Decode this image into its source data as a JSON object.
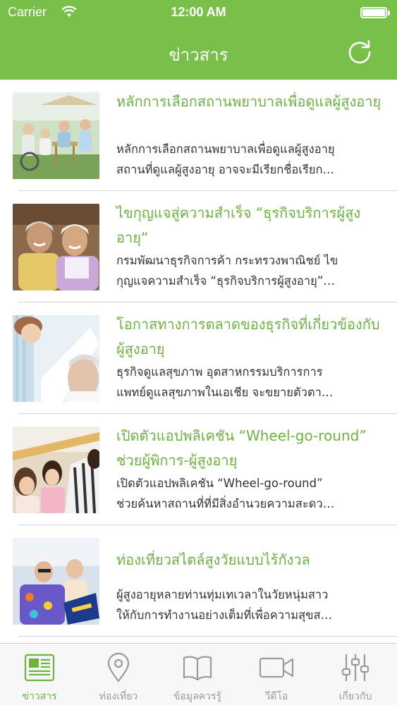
{
  "status_bar": {
    "carrier": "Carrier",
    "time": "12:00 AM"
  },
  "nav": {
    "title": "ข่าวสาร"
  },
  "articles": [
    {
      "title": "หลักการเลือกสถานพยาบาลเพื่อดูแลผู้สูงอายุ",
      "desc_line1": "หลักการเลือกสถานพยาบาลเพื่อดูแลผู้สูงอายุ",
      "desc_line2": "สถานที่ดูแลผู้สูงอายุ อาจจะมีเรียกชื่อเรียก…"
    },
    {
      "title": "ไขกุญแจสู่ความสำเร็จ “ธุรกิจบริการผู้สูงอายุ“",
      "desc_line1": "กรมพัฒนาธุรกิจการค้า กระทรวงพาณิชย์ ไข",
      "desc_line2": "กุญแจความสำเร็จ “ธุรกิจบริการผู้สูงอายุ”…"
    },
    {
      "title": "โอกาสทางการตลาดของธุรกิจที่เกี่ยวข้องกับผู้สูงอายุ",
      "desc_line1": "ธุรกิจดูแลสุขภาพ อุตสาหกรรมบริการการ",
      "desc_line2": "แพทย์ดูแลสุขภาพในเอเชีย จะขยายตัวตา…"
    },
    {
      "title": "เปิดตัวแอปพลิเคชัน “Wheel-go-round” ช่วยผู้พิการ-ผู้สูงอายุ",
      "desc_line1": "เปิดตัวแอปพลิเคชัน “Wheel-go-round”",
      "desc_line2": "ช่วยค้นหาสถานที่ที่มีสิ่งอำนวยความสะดว…"
    },
    {
      "title": "ท่องเที่ยวสไตล์สูงวัยแบบไร้กังวล",
      "desc_line1": "ผู้สูงอายุหลายท่านทุ่มเทเวลาในวัยหนุ่มสาว",
      "desc_line2": "ให้กับการทำงานอย่างเต็มที่เพื่อความสุขส…"
    }
  ],
  "tabs": [
    {
      "label": "ข่าวสาร",
      "icon": "newspaper-icon",
      "active": true
    },
    {
      "label": "ท่องเที่ยว",
      "icon": "map-pin-icon",
      "active": false
    },
    {
      "label": "ข้อมูลควรรู้",
      "icon": "book-icon",
      "active": false
    },
    {
      "label": "วีดีโอ",
      "icon": "video-camera-icon",
      "active": false
    },
    {
      "label": "เกี่ยวกับ",
      "icon": "sliders-icon",
      "active": false
    }
  ],
  "colors": {
    "accent": "#79c04a",
    "title_green": "#6cb33f",
    "tab_inactive": "#9a9a9a"
  }
}
